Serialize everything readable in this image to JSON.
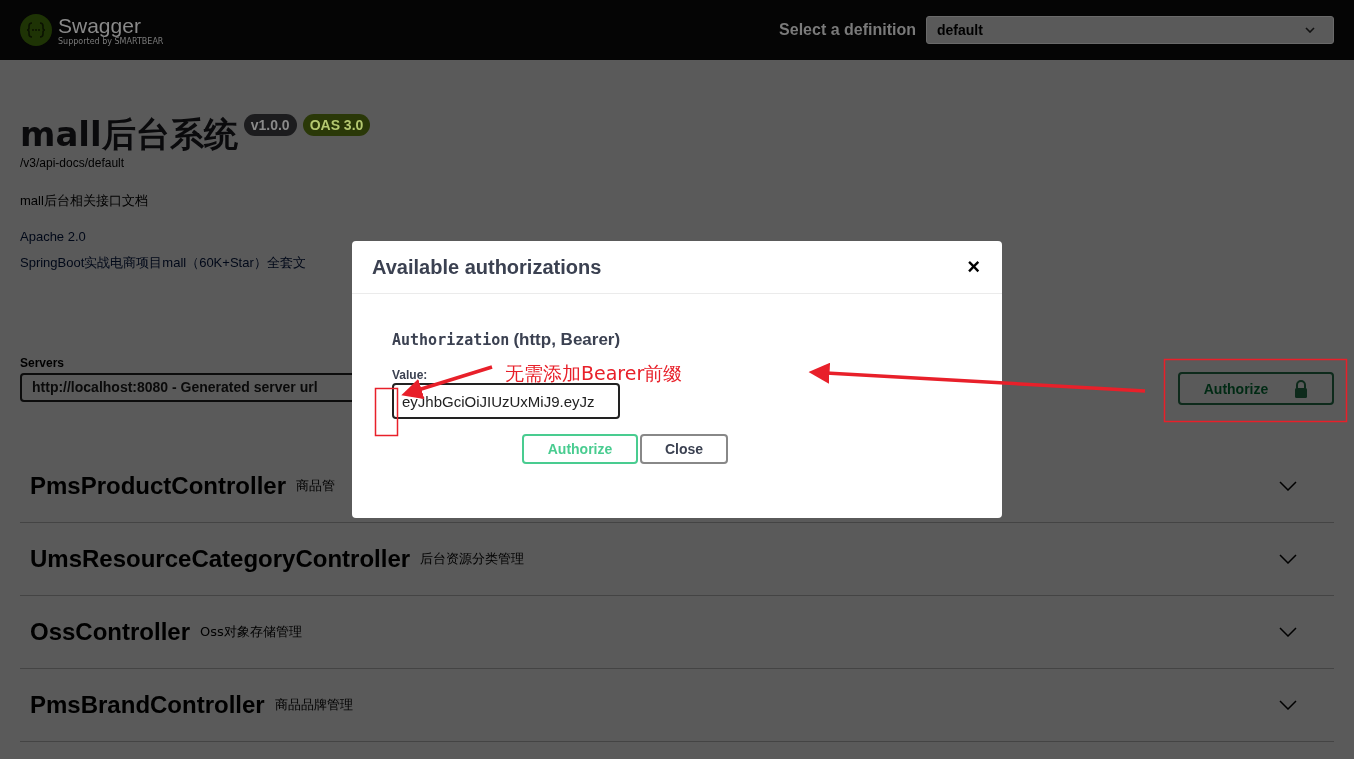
{
  "topbar": {
    "logo_name": "Swagger",
    "logo_tagline": "Supported by SMARTBEAR",
    "definition_label": "Select a definition",
    "definition_value": "default"
  },
  "info": {
    "title": "mall后台系统",
    "badges": [
      {
        "text": "v1.0.0",
        "kind": "version"
      },
      {
        "text": "OAS 3.0",
        "kind": "oas"
      }
    ],
    "url": "/v3/api-docs/default",
    "description": "mall后台相关接口文档",
    "links": [
      "Apache 2.0",
      "SpringBoot实战电商项目mall（60K+Star）全套文"
    ]
  },
  "servers": {
    "label": "Servers",
    "value": "http://localhost:8080 - Generated server url"
  },
  "authorize_button": {
    "label": "Authorize"
  },
  "controllers": [
    {
      "name": "PmsProductController",
      "description": "商品管"
    },
    {
      "name": "UmsResourceCategoryController",
      "description": "后台资源分类管理"
    },
    {
      "name": "OssController",
      "description": "Oss对象存储管理"
    },
    {
      "name": "PmsBrandController",
      "description": "商品品牌管理"
    }
  ],
  "modal": {
    "title": "Available authorizations",
    "close": "×",
    "scheme_name": "Authorization",
    "scheme_type": "(http, Bearer)",
    "value_label": "Value:",
    "value": "eyJhbGciOiJIUzUxMiJ9.eyJz",
    "buttons": [
      {
        "label": "Authorize",
        "kind": "primary"
      },
      {
        "label": "Close",
        "kind": "secondary"
      }
    ]
  },
  "annotation": {
    "text": "无需添加Bearer前缀"
  }
}
